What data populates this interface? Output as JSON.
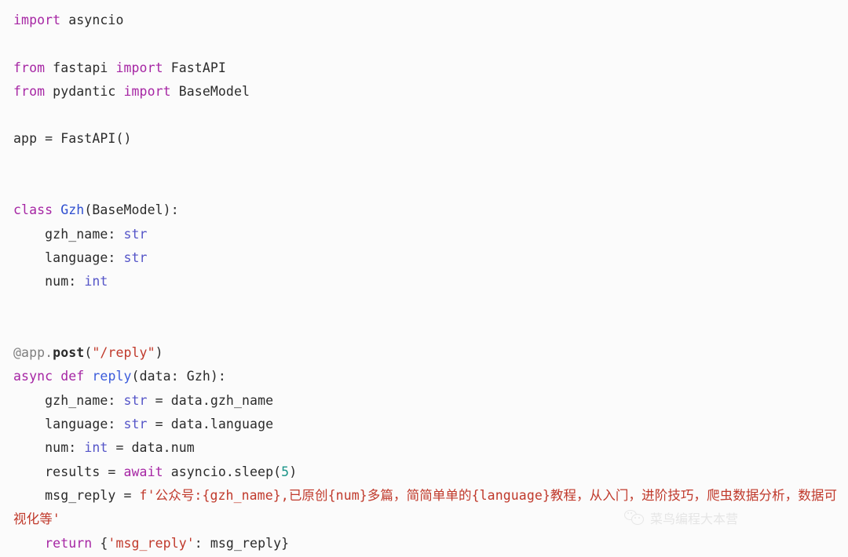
{
  "editor": {
    "background": "#fbfbfb",
    "default_text_color": "#2b2b2b",
    "language": "python",
    "palette": {
      "keyword": "#a626a4",
      "builtin_type": "#5555c8",
      "class_name": "#2f4fd0",
      "function_name": "#3b5bdb",
      "string": "#c0392b",
      "number": "#1a9488",
      "decorator": "#7f7f7f"
    }
  },
  "code": {
    "l1": {
      "kw_import": "import",
      "module": " asyncio"
    },
    "l3": {
      "kw_from": "from",
      "module": " fastapi ",
      "kw_import": "import",
      "name": " FastAPI"
    },
    "l4": {
      "kw_from": "from",
      "module": " pydantic ",
      "kw_import": "import",
      "name": " BaseModel"
    },
    "l6": {
      "text": "app = FastAPI()"
    },
    "l9": {
      "kw_class": "class",
      "space": " ",
      "class_name": "Gzh",
      "rest": "(BaseModel):"
    },
    "l10": {
      "indent": "    ",
      "name": "gzh_name: ",
      "type": "str"
    },
    "l11": {
      "indent": "    ",
      "name": "language: ",
      "type": "str"
    },
    "l12": {
      "indent": "    ",
      "name": "num: ",
      "type": "int"
    },
    "l15": {
      "deco_at": "@app.",
      "deco_fn": "post",
      "paren_open": "(",
      "route": "\"/reply\"",
      "paren_close": ")"
    },
    "l16": {
      "kw_async": "async",
      "space1": " ",
      "kw_def": "def",
      "space2": " ",
      "fn_name": "reply",
      "rest": "(data: Gzh):"
    },
    "l17": {
      "indent": "    ",
      "name": "gzh_name: ",
      "type": "str",
      "assign": " = data.gzh_name"
    },
    "l18": {
      "indent": "    ",
      "name": "language: ",
      "type": "str",
      "assign": " = data.language"
    },
    "l19": {
      "indent": "    ",
      "name": "num: ",
      "type": "int",
      "assign": " = data.num"
    },
    "l20": {
      "indent": "    ",
      "lhs": "results = ",
      "kw_await": "await",
      "call": " asyncio.sleep(",
      "num": "5",
      "close": ")"
    },
    "l21": {
      "indent": "    ",
      "lhs": "msg_reply = ",
      "fstring": "f'公众号:{gzh_name},已原创{num}多篇，简简单单的{language}教程，从入门，进阶技巧，爬虫数据分析，数据可视化等'"
    },
    "l22": {
      "indent": "    ",
      "kw_return": "return",
      "brace_open": " {",
      "key": "'msg_reply'",
      "rest": ": msg_reply}"
    }
  },
  "watermark": {
    "icon": "wechat-icon",
    "text": "菜鸟编程大本营"
  }
}
